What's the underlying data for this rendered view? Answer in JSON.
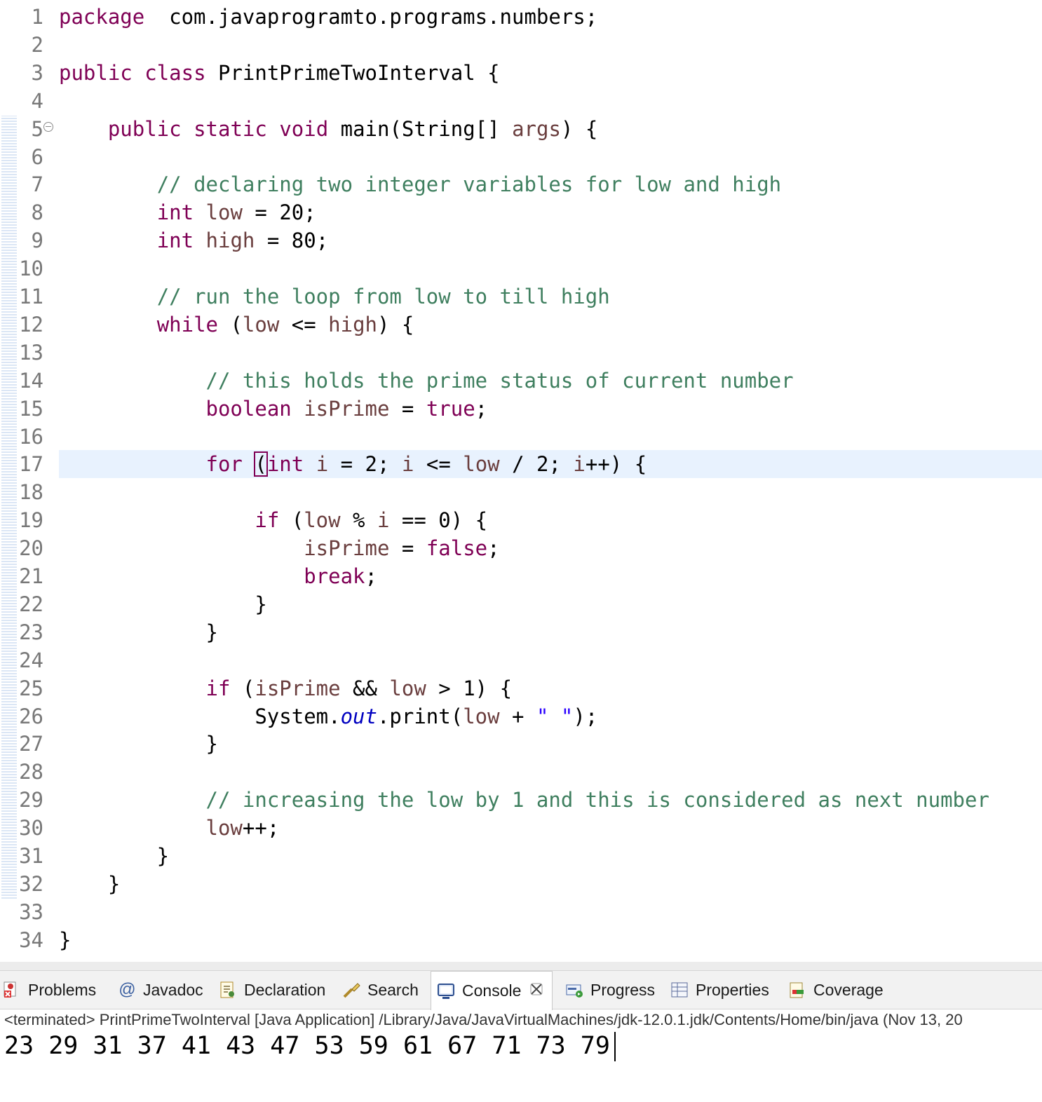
{
  "editor": {
    "lines": [
      {
        "n": "1",
        "tokens": [
          [
            "kw",
            "package"
          ],
          [
            "",
            "  com.javaprogramto.programs.numbers;"
          ]
        ]
      },
      {
        "n": "2",
        "tokens": []
      },
      {
        "n": "3",
        "tokens": [
          [
            "kw",
            "public"
          ],
          [
            "",
            " "
          ],
          [
            "kw",
            "class"
          ],
          [
            "",
            " PrintPrimeTwoInterval {"
          ]
        ]
      },
      {
        "n": "4",
        "tokens": []
      },
      {
        "n": "5",
        "fold": true,
        "tokens": [
          [
            "",
            "    "
          ],
          [
            "kw",
            "public"
          ],
          [
            "",
            " "
          ],
          [
            "kw",
            "static"
          ],
          [
            "",
            " "
          ],
          [
            "kw",
            "void"
          ],
          [
            "",
            " main(String[] "
          ],
          [
            "var",
            "args"
          ],
          [
            "",
            ") {"
          ]
        ]
      },
      {
        "n": "6",
        "tokens": []
      },
      {
        "n": "7",
        "tokens": [
          [
            "",
            "        "
          ],
          [
            "cm",
            "// declaring two integer variables for low and high"
          ]
        ]
      },
      {
        "n": "8",
        "tokens": [
          [
            "",
            "        "
          ],
          [
            "kw",
            "int"
          ],
          [
            "",
            " "
          ],
          [
            "var",
            "low"
          ],
          [
            "",
            " = 20;"
          ]
        ]
      },
      {
        "n": "9",
        "tokens": [
          [
            "",
            "        "
          ],
          [
            "kw",
            "int"
          ],
          [
            "",
            " "
          ],
          [
            "var",
            "high"
          ],
          [
            "",
            " = 80;"
          ]
        ]
      },
      {
        "n": "10",
        "tokens": []
      },
      {
        "n": "11",
        "tokens": [
          [
            "",
            "        "
          ],
          [
            "cm",
            "// run the loop from low to till high"
          ]
        ]
      },
      {
        "n": "12",
        "tokens": [
          [
            "",
            "        "
          ],
          [
            "kw",
            "while"
          ],
          [
            "",
            " ("
          ],
          [
            "var",
            "low"
          ],
          [
            "",
            " <= "
          ],
          [
            "var",
            "high"
          ],
          [
            "",
            ") {"
          ]
        ]
      },
      {
        "n": "13",
        "tokens": []
      },
      {
        "n": "14",
        "tokens": [
          [
            "",
            "            "
          ],
          [
            "cm",
            "// this holds the prime status of current number"
          ]
        ]
      },
      {
        "n": "15",
        "tokens": [
          [
            "",
            "            "
          ],
          [
            "kw",
            "boolean"
          ],
          [
            "",
            " "
          ],
          [
            "var",
            "isPrime"
          ],
          [
            "",
            " = "
          ],
          [
            "kw",
            "true"
          ],
          [
            "",
            ";"
          ]
        ]
      },
      {
        "n": "16",
        "tokens": []
      },
      {
        "n": "17",
        "current": true,
        "tokens": [
          [
            "",
            "            "
          ],
          [
            "kw",
            "for"
          ],
          [
            "",
            " "
          ],
          [
            "caret",
            "("
          ],
          [
            "kw",
            "int"
          ],
          [
            "",
            " "
          ],
          [
            "var",
            "i"
          ],
          [
            "",
            " = 2; "
          ],
          [
            "var",
            "i"
          ],
          [
            "",
            " <= "
          ],
          [
            "var",
            "low"
          ],
          [
            "",
            " / 2; "
          ],
          [
            "var",
            "i"
          ],
          [
            "",
            "++) {"
          ]
        ]
      },
      {
        "n": "18",
        "tokens": []
      },
      {
        "n": "19",
        "tokens": [
          [
            "",
            "                "
          ],
          [
            "kw",
            "if"
          ],
          [
            "",
            " ("
          ],
          [
            "var",
            "low"
          ],
          [
            "",
            " % "
          ],
          [
            "var",
            "i"
          ],
          [
            "",
            " == 0) {"
          ]
        ]
      },
      {
        "n": "20",
        "tokens": [
          [
            "",
            "                    "
          ],
          [
            "var",
            "isPrime"
          ],
          [
            "",
            " = "
          ],
          [
            "kw",
            "false"
          ],
          [
            "",
            ";"
          ]
        ]
      },
      {
        "n": "21",
        "tokens": [
          [
            "",
            "                    "
          ],
          [
            "kw",
            "break"
          ],
          [
            "",
            ";"
          ]
        ]
      },
      {
        "n": "22",
        "tokens": [
          [
            "",
            "                }"
          ]
        ]
      },
      {
        "n": "23",
        "tokens": [
          [
            "",
            "            }"
          ]
        ]
      },
      {
        "n": "24",
        "tokens": []
      },
      {
        "n": "25",
        "tokens": [
          [
            "",
            "            "
          ],
          [
            "kw",
            "if"
          ],
          [
            "",
            " ("
          ],
          [
            "var",
            "isPrime"
          ],
          [
            "",
            " && "
          ],
          [
            "var",
            "low"
          ],
          [
            "",
            " > 1) {"
          ]
        ]
      },
      {
        "n": "26",
        "tokens": [
          [
            "",
            "                System."
          ],
          [
            "fld",
            "out"
          ],
          [
            "",
            ".print("
          ],
          [
            "var",
            "low"
          ],
          [
            "",
            " + "
          ],
          [
            "str",
            "\" \""
          ],
          [
            "",
            ");"
          ]
        ]
      },
      {
        "n": "27",
        "tokens": [
          [
            "",
            "            }"
          ]
        ]
      },
      {
        "n": "28",
        "tokens": []
      },
      {
        "n": "29",
        "tokens": [
          [
            "",
            "            "
          ],
          [
            "cm",
            "// increasing the low by 1 and this is considered as next number"
          ]
        ]
      },
      {
        "n": "30",
        "tokens": [
          [
            "",
            "            "
          ],
          [
            "var",
            "low"
          ],
          [
            "",
            "++;"
          ]
        ]
      },
      {
        "n": "31",
        "tokens": [
          [
            "",
            "        }"
          ]
        ]
      },
      {
        "n": "32",
        "tokens": [
          [
            "",
            "    }"
          ]
        ]
      },
      {
        "n": "33",
        "tokens": []
      },
      {
        "n": "34",
        "tokens": [
          [
            "",
            "}"
          ]
        ]
      }
    ]
  },
  "panel": {
    "tabs": [
      {
        "label": "Problems",
        "icon": "problems-icon"
      },
      {
        "label": "Javadoc",
        "icon": "javadoc-icon"
      },
      {
        "label": "Declaration",
        "icon": "declaration-icon"
      },
      {
        "label": "Search",
        "icon": "search-icon"
      },
      {
        "label": "Console",
        "icon": "console-icon",
        "active": true
      },
      {
        "label": "Progress",
        "icon": "progress-icon"
      },
      {
        "label": "Properties",
        "icon": "properties-icon"
      },
      {
        "label": "Coverage",
        "icon": "coverage-icon"
      }
    ],
    "console_header": "<terminated> PrintPrimeTwoInterval [Java Application] /Library/Java/JavaVirtualMachines/jdk-12.0.1.jdk/Contents/Home/bin/java  (Nov 13, 20",
    "console_output": "23 29 31 37 41 43 47 53 59 61 67 71 73 79"
  }
}
